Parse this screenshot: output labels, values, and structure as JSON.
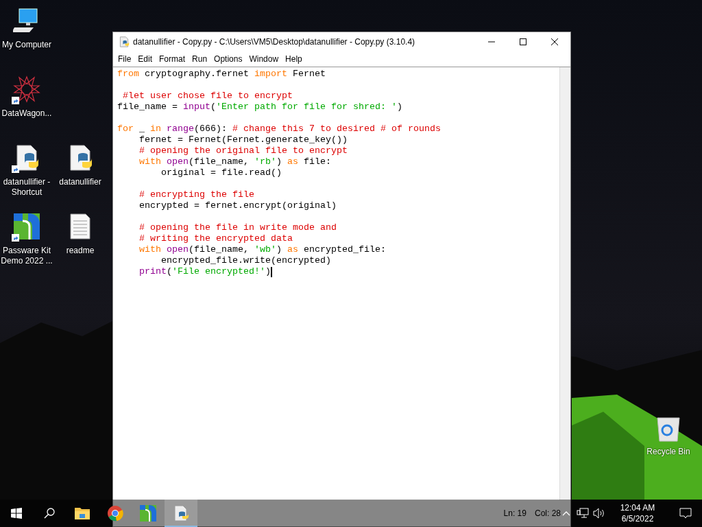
{
  "desktop": {
    "icons": [
      {
        "label": "My Computer",
        "kind": "computer",
        "shortcut": false
      },
      {
        "label": "DataWagon...",
        "kind": "star",
        "shortcut": true
      },
      {
        "label": "datanullifier - Shortcut",
        "kind": "python",
        "shortcut": true
      },
      {
        "label": "datanullifier",
        "kind": "python",
        "shortcut": false
      },
      {
        "label": "Passware Kit Demo 2022 ...",
        "kind": "passware",
        "shortcut": true
      },
      {
        "label": "readme",
        "kind": "text",
        "shortcut": false
      }
    ],
    "recycle_bin": {
      "label": "Recycle Bin"
    }
  },
  "window": {
    "title": "datanullifier - Copy.py - C:\\Users\\VM5\\Desktop\\datanullifier - Copy.py (3.10.4)",
    "menu": [
      "File",
      "Edit",
      "Format",
      "Run",
      "Options",
      "Window",
      "Help"
    ],
    "code": [
      {
        "kind": "code",
        "tokens": [
          {
            "text": "from",
            "kind": "keyword"
          },
          {
            "text": " cryptography.fernet ",
            "kind": "plain"
          },
          {
            "text": "import",
            "kind": "keyword"
          },
          {
            "text": " Fernet",
            "kind": "plain"
          }
        ]
      },
      {
        "kind": "blank"
      },
      {
        "kind": "code",
        "tokens": [
          {
            "text": " #let user chose file to encrypt",
            "kind": "comment"
          }
        ]
      },
      {
        "kind": "code",
        "tokens": [
          {
            "text": "file_name = ",
            "kind": "plain"
          },
          {
            "text": "input",
            "kind": "builtin"
          },
          {
            "text": "(",
            "kind": "plain"
          },
          {
            "text": "'Enter path for file for shred: '",
            "kind": "string"
          },
          {
            "text": ")",
            "kind": "plain"
          }
        ]
      },
      {
        "kind": "blank"
      },
      {
        "kind": "code",
        "tokens": [
          {
            "text": "for",
            "kind": "keyword"
          },
          {
            "text": " _ ",
            "kind": "plain"
          },
          {
            "text": "in ",
            "kind": "keyword"
          },
          {
            "text": "range",
            "kind": "builtin"
          },
          {
            "text": "(666): ",
            "kind": "plain"
          },
          {
            "text": "# change this 7 to desired # of rounds",
            "kind": "comment"
          }
        ]
      },
      {
        "kind": "code",
        "tokens": [
          {
            "text": "    fernet = Fernet(Fernet.generate_key())",
            "kind": "plain"
          }
        ]
      },
      {
        "kind": "code",
        "tokens": [
          {
            "text": "    # opening the original file to encrypt",
            "kind": "comment"
          }
        ]
      },
      {
        "kind": "code",
        "tokens": [
          {
            "text": "    with ",
            "kind": "keyword"
          },
          {
            "text": "open",
            "kind": "builtin"
          },
          {
            "text": "(file_name, ",
            "kind": "plain"
          },
          {
            "text": "'rb'",
            "kind": "string"
          },
          {
            "text": ") ",
            "kind": "plain"
          },
          {
            "text": "as",
            "kind": "keyword"
          },
          {
            "text": " file:",
            "kind": "plain"
          }
        ]
      },
      {
        "kind": "code",
        "tokens": [
          {
            "text": "        original = file.read()",
            "kind": "plain"
          }
        ]
      },
      {
        "kind": "blank"
      },
      {
        "kind": "code",
        "tokens": [
          {
            "text": "    # encrypting the file",
            "kind": "comment"
          }
        ]
      },
      {
        "kind": "code",
        "tokens": [
          {
            "text": "    encrypted = fernet.encrypt(original)",
            "kind": "plain"
          }
        ]
      },
      {
        "kind": "blank"
      },
      {
        "kind": "code",
        "tokens": [
          {
            "text": "    # opening the file in write mode and",
            "kind": "comment"
          }
        ]
      },
      {
        "kind": "code",
        "tokens": [
          {
            "text": "    # writing the encrypted data",
            "kind": "comment"
          }
        ]
      },
      {
        "kind": "code",
        "tokens": [
          {
            "text": "    with ",
            "kind": "keyword"
          },
          {
            "text": "open",
            "kind": "builtin"
          },
          {
            "text": "(file_name, ",
            "kind": "plain"
          },
          {
            "text": "'wb'",
            "kind": "string"
          },
          {
            "text": ") ",
            "kind": "plain"
          },
          {
            "text": "as",
            "kind": "keyword"
          },
          {
            "text": " encrypted_file:",
            "kind": "plain"
          }
        ]
      },
      {
        "kind": "code",
        "tokens": [
          {
            "text": "        encrypted_file.write(encrypted)",
            "kind": "plain"
          }
        ]
      },
      {
        "kind": "code",
        "tokens": [
          {
            "text": "    print",
            "kind": "builtin"
          },
          {
            "text": "(",
            "kind": "plain"
          },
          {
            "text": "'File encrypted!'",
            "kind": "string"
          },
          {
            "text": ")",
            "kind": "plain"
          }
        ]
      }
    ],
    "status_bar": {
      "line": "Ln: 19",
      "column": "Col: 28"
    }
  },
  "taskbar": {
    "apps": [
      {
        "kind": "folder",
        "selected": false
      },
      {
        "kind": "chrome",
        "selected": false
      },
      {
        "kind": "passware",
        "selected": false
      },
      {
        "kind": "python",
        "selected": true
      }
    ],
    "time": "12:04 AM",
    "date": "6/5/2022"
  }
}
